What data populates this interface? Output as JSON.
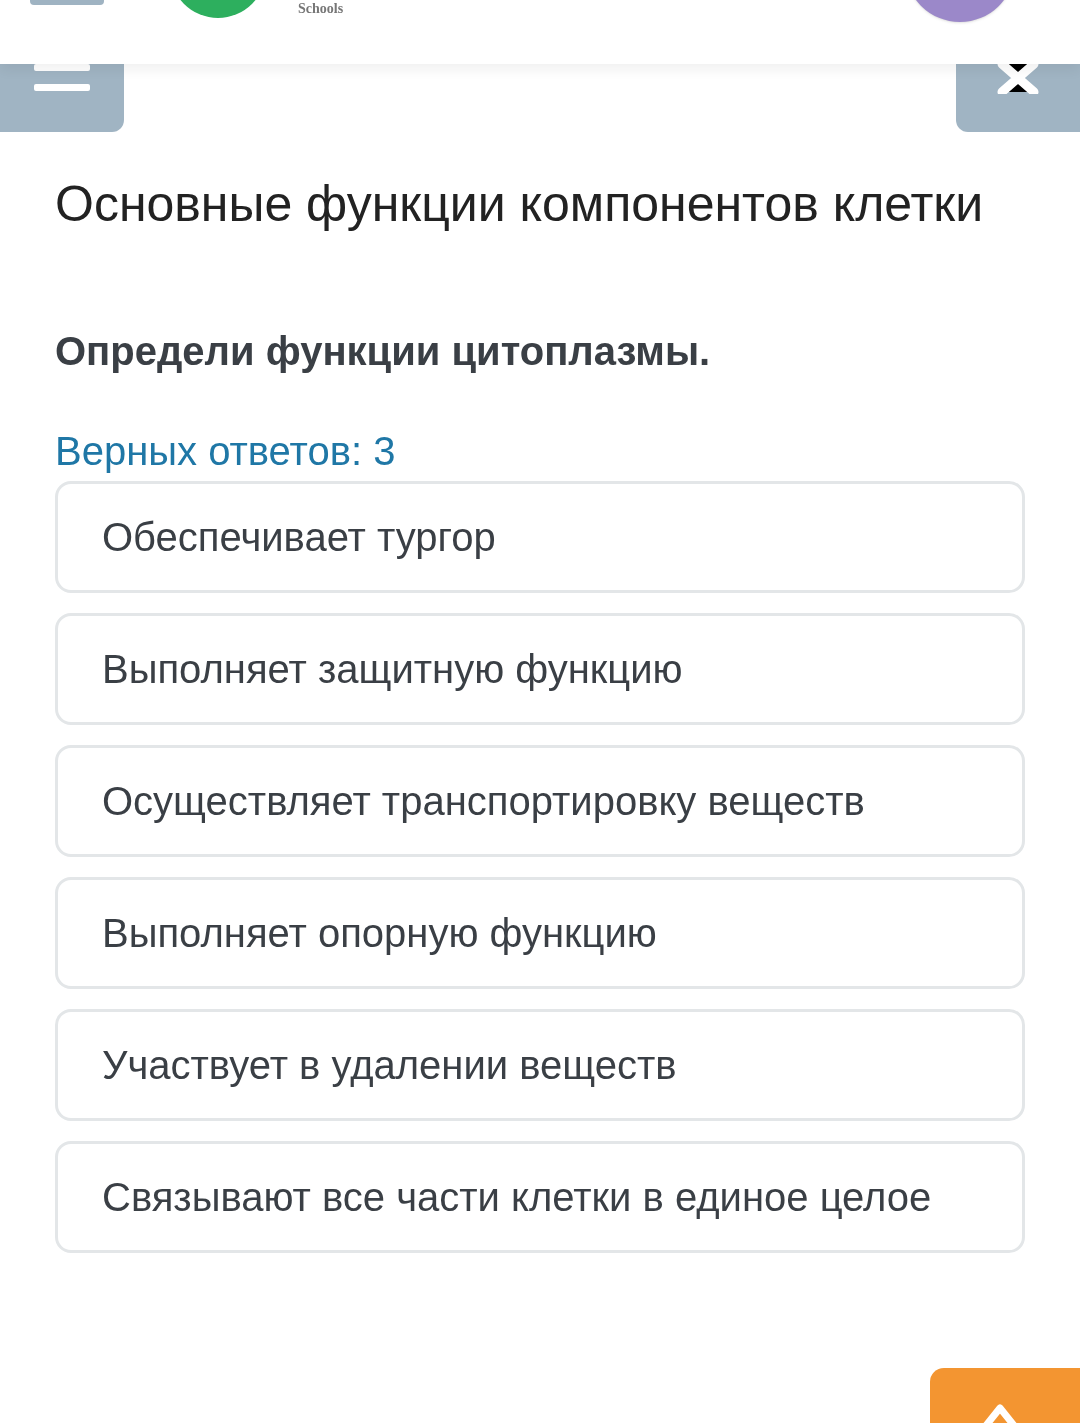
{
  "header": {
    "logo_text": "Schools"
  },
  "title": "Основные функции компонентов клетки",
  "question": "Определи функции цитоплазмы.",
  "answer_count": "Верных ответов: 3",
  "options": [
    {
      "label": "Обеспечивает тургор"
    },
    {
      "label": "Выполняет защитную функцию"
    },
    {
      "label": "Осуществляет транспортировку веществ"
    },
    {
      "label": "Выполняет опорную функцию"
    },
    {
      "label": "Участвует в удалении веществ"
    },
    {
      "label": "Связывают все части клетки в единое целое"
    }
  ]
}
